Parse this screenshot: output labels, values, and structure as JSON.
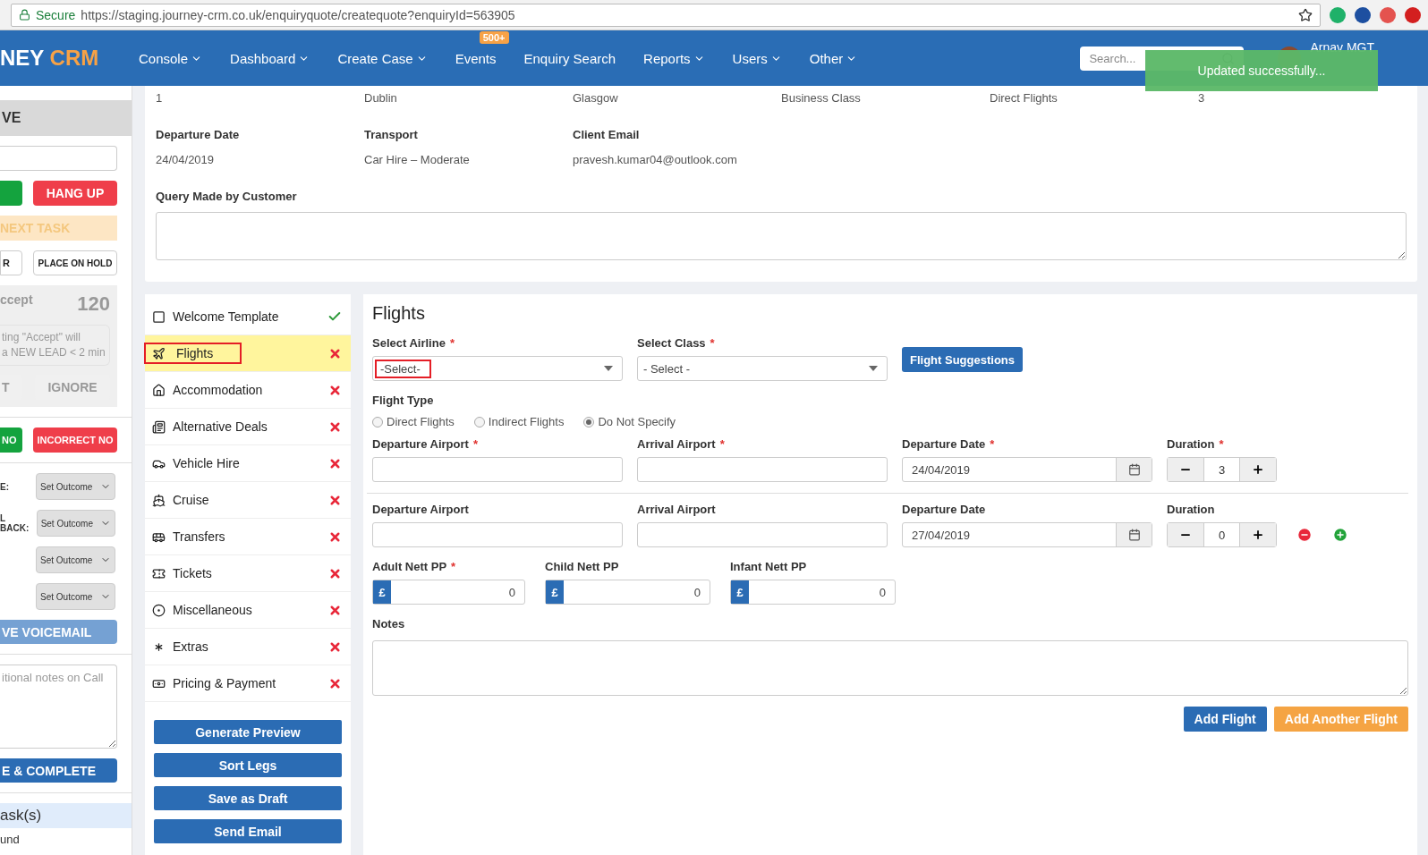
{
  "browser": {
    "secure_label": "Secure",
    "url": "https://staging.journey-crm.co.uk/enquiryquote/createquote?enquiryId=563905"
  },
  "nav": {
    "logo_main": "NEY",
    "logo_accent": "CRM",
    "items": [
      {
        "label": "Console",
        "caret": true
      },
      {
        "label": "Dashboard",
        "caret": true
      },
      {
        "label": "Create Case",
        "caret": true
      },
      {
        "label": "Events",
        "caret": false,
        "badge": "500+"
      },
      {
        "label": "Enquiry Search",
        "caret": false
      },
      {
        "label": "Reports",
        "caret": true
      },
      {
        "label": "Users",
        "caret": true
      },
      {
        "label": "Other",
        "caret": true
      }
    ],
    "search_placeholder": "Search...",
    "user_name": "Arnav MGT",
    "toast": "Updated successfully..."
  },
  "side_panel": {
    "header": "VE",
    "call_buttons": [
      {
        "kind": "green"
      },
      {
        "label": "HANG UP",
        "kind": "red"
      }
    ],
    "next_task": "NEXT TASK",
    "hold_buttons": [
      "R",
      "PLACE ON HOLD"
    ],
    "lead": {
      "title": "ccept",
      "count": "120",
      "note_lines": [
        "ting \"Accept\" will",
        "a NEW LEAD < 2 min"
      ],
      "buttons": [
        "T",
        "IGNORE"
      ]
    },
    "number_buttons": [
      {
        "label": "NO",
        "kind": "green"
      },
      {
        "label": "INCORRECT NO",
        "kind": "red"
      }
    ],
    "outcomes": [
      {
        "label": "E:",
        "value": "Set Outcome"
      },
      {
        "label": "L BACK:",
        "value": "Set Outcome"
      },
      {
        "value": "Set Outcome"
      },
      {
        "value": "Set Outcome"
      }
    ],
    "voicemail": "VE VOICEMAIL",
    "notes_placeholder": "itional notes on Call",
    "complete": "E & COMPLETE",
    "tasks_title": "ask(s)",
    "tasks_text": "und"
  },
  "summary": {
    "top_values": [
      "1",
      "Dublin",
      "Glasgow",
      "Business Class",
      "Direct Flights",
      "3"
    ],
    "fields": [
      {
        "label": "Departure Date",
        "value": "24/04/2019"
      },
      {
        "label": "Transport",
        "value": "Car Hire – Moderate"
      },
      {
        "label": "Client Email",
        "value": "pravesh.kumar04@outlook.com"
      }
    ],
    "query_label": "Query Made by Customer"
  },
  "sections": [
    {
      "label": "Welcome Template",
      "done": true,
      "selected": false
    },
    {
      "label": "Flights",
      "done": false,
      "selected": true
    },
    {
      "label": "Accommodation",
      "done": false,
      "selected": false
    },
    {
      "label": "Alternative Deals",
      "done": false,
      "selected": false
    },
    {
      "label": "Vehicle Hire",
      "done": false,
      "selected": false
    },
    {
      "label": "Cruise",
      "done": false,
      "selected": false
    },
    {
      "label": "Transfers",
      "done": false,
      "selected": false
    },
    {
      "label": "Tickets",
      "done": false,
      "selected": false
    },
    {
      "label": "Miscellaneous",
      "done": false,
      "selected": false
    },
    {
      "label": "Extras",
      "done": false,
      "selected": false
    },
    {
      "label": "Pricing & Payment",
      "done": false,
      "selected": false
    }
  ],
  "section_buttons": [
    "Generate Preview",
    "Sort Legs",
    "Save as Draft",
    "Send Email"
  ],
  "flights": {
    "title": "Flights",
    "airline_label": {
      "text": "Select Airline",
      "mark": "*"
    },
    "airline_value": "-Select-",
    "airline_highlighted": true,
    "class_label": {
      "text": "Select Class",
      "mark": "*"
    },
    "class_value": "- Select -",
    "suggestions": "Flight Suggestions",
    "type_label": {
      "text": "Flight Type"
    },
    "types": [
      {
        "label": "Direct Flights",
        "selected": false
      },
      {
        "label": "Indirect Flights",
        "selected": false
      },
      {
        "label": "Do Not Specify",
        "selected": true
      }
    ],
    "legs": [
      {
        "departure_label": {
          "text": "Departure Airport",
          "mark": "*"
        },
        "arrival_label": {
          "text": "Arrival Airport",
          "mark": "*"
        },
        "date_label": {
          "text": "Departure Date",
          "mark": "*"
        },
        "date": "24/04/2019",
        "duration_label": {
          "text": "Duration",
          "mark": "*"
        },
        "duration": "3",
        "removable": false
      },
      {
        "departure_label": {
          "text": "Departure Airport"
        },
        "arrival_label": {
          "text": "Arrival Airport"
        },
        "date_label": {
          "text": "Departure Date"
        },
        "date": "27/04/2019",
        "duration_label": {
          "text": "Duration"
        },
        "duration": "0",
        "removable": true
      }
    ],
    "prices": [
      {
        "label": {
          "text": "Adult Nett PP",
          "mark": "*"
        },
        "currency": "£",
        "value": "0"
      },
      {
        "label": {
          "text": "Child Nett PP"
        },
        "currency": "£",
        "value": "0"
      },
      {
        "label": {
          "text": "Infant Nett PP"
        },
        "currency": "£",
        "value": "0"
      }
    ],
    "notes_label": {
      "text": "Notes"
    },
    "buttons": [
      {
        "label": "Add Flight",
        "kind": "primary"
      },
      {
        "label": "Add Another Flight",
        "kind": "warning"
      }
    ]
  }
}
